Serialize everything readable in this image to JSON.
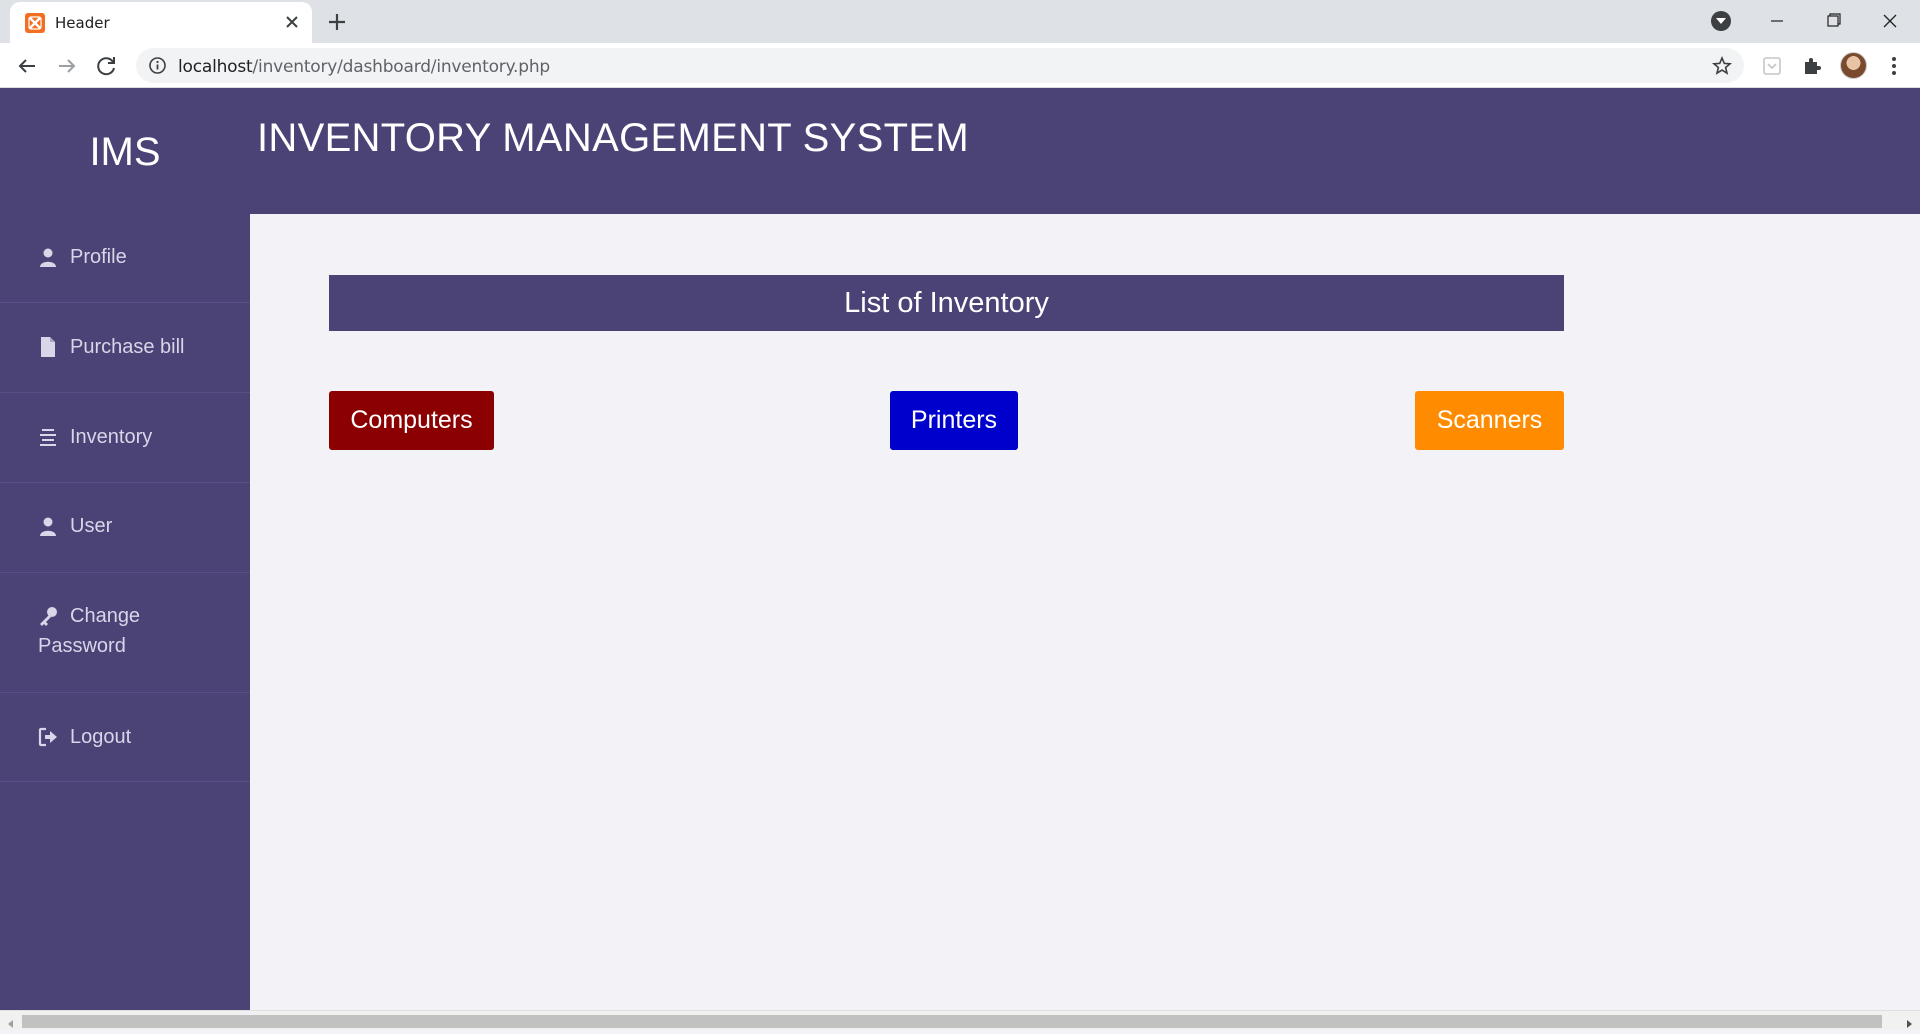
{
  "browser": {
    "tab_title": "Header",
    "url_host": "localhost",
    "url_path": "/inventory/dashboard/inventory.php"
  },
  "app": {
    "logo": "IMS",
    "title": "INVENTORY MANAGEMENT SYSTEM"
  },
  "sidebar": {
    "items": [
      {
        "label": "Profile",
        "icon": "user-icon"
      },
      {
        "label": "Purchase bill",
        "icon": "file-icon"
      },
      {
        "label": "Inventory",
        "icon": "list-icon"
      },
      {
        "label": "User",
        "icon": "user-icon"
      },
      {
        "label_line1": "Change",
        "label_line2": "Password",
        "icon": "key-icon"
      },
      {
        "label": "Logout",
        "icon": "logout-icon"
      }
    ]
  },
  "main": {
    "list_title": "List of Inventory",
    "buttons": [
      {
        "label": "Computers",
        "color": "#8b0000"
      },
      {
        "label": "Printers",
        "color": "#0000cd"
      },
      {
        "label": "Scanners",
        "color": "#ff8c00"
      }
    ]
  },
  "colors": {
    "brand": "#4b4276",
    "background": "#f3f3f7"
  }
}
